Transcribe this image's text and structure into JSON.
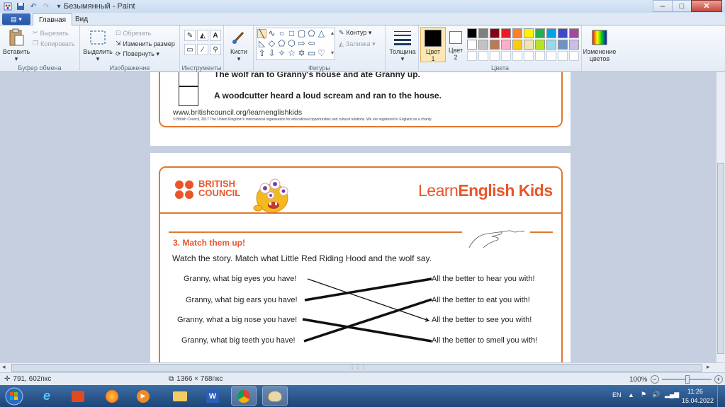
{
  "window": {
    "title": "Безымянный - Paint",
    "minimize": "–",
    "maximize": "□",
    "close": "✕"
  },
  "tabs": {
    "file": "▤ ▾",
    "home": "Главная",
    "view": "Вид"
  },
  "ribbon": {
    "clipboard": {
      "paste": "Вставить",
      "cut": "Вырезать",
      "copy": "Копировать",
      "label": "Буфер обмена"
    },
    "image": {
      "select": "Выделить",
      "crop": "Обрезать",
      "resize": "Изменить размер",
      "rotate": "Повернуть ▾",
      "label": "Изображение"
    },
    "tools": {
      "label": "Инструменты"
    },
    "brushes": {
      "label": "Кисти"
    },
    "shapes": {
      "outline": "Контур ▾",
      "fill": "Заливка ▾",
      "label": "Фигуры"
    },
    "size": {
      "label": "Толщина"
    },
    "color1": {
      "line1": "Цвет",
      "line2": "1"
    },
    "color2": {
      "line1": "Цвет",
      "line2": "2"
    },
    "colors": {
      "label": "Цвета",
      "edit_line1": "Изменение",
      "edit_line2": "цветов",
      "row1": [
        "#000000",
        "#7f7f7f",
        "#880015",
        "#ed1c24",
        "#ff7f27",
        "#fff200",
        "#22b14c",
        "#00a2e8",
        "#3f48cc",
        "#a349a4"
      ],
      "row2": [
        "#ffffff",
        "#c3c3c3",
        "#b97a57",
        "#ffaec9",
        "#ffc90e",
        "#efe4b0",
        "#b5e61d",
        "#99d9ea",
        "#7092be",
        "#c8bfe7"
      ]
    }
  },
  "page1": {
    "line1": "The wolf ran to Granny's house and ate Granny up.",
    "line2": "A woodcutter heard a loud scream and ran to the house.",
    "url": "www.britishcouncil.org/learnenglishkids",
    "copyright": "© British Council, 2017 The United Kingdom's international organisation for educational opportunities and cultural relations. We are registered in England as a charity."
  },
  "page2": {
    "brand1": "BRITISH",
    "brand2": "COUNCIL",
    "learn_a": "Learn",
    "learn_b": "English Kids",
    "section": "3. Match them up!",
    "instruction": "Watch the story. Match what Little Red Riding Hood and the wolf say.",
    "left": [
      "Granny, what big eyes you have!",
      "Granny, what big ears you have!",
      "Granny, what a big nose you have!",
      "Granny, what big teeth you have!"
    ],
    "right": [
      "All the better to hear you with!",
      "All the better to eat you with!",
      "All the better to see you with!",
      "All the better to smell you with!"
    ]
  },
  "status": {
    "cursor": "791, 602пкс",
    "size": "1366 × 768пкс",
    "zoom": "100%",
    "zoom_out": "−",
    "zoom_in": "+"
  },
  "taskbar": {
    "lang": "EN",
    "time": "11:26",
    "date": "15.04.2022"
  }
}
